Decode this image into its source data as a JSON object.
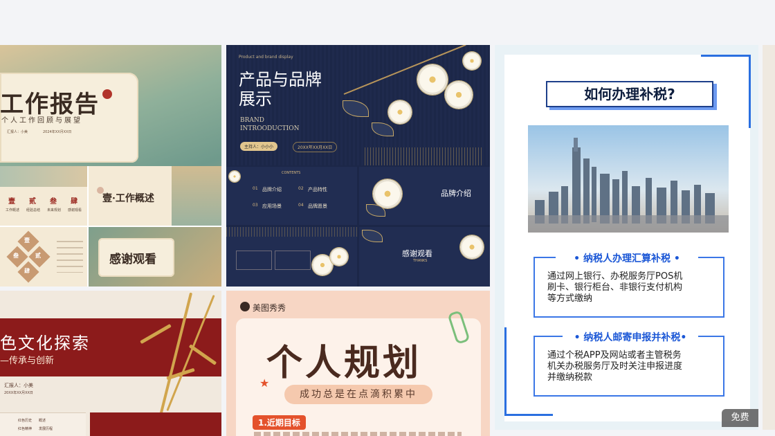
{
  "card1": {
    "title": "工作报告",
    "subtitle": "个人工作回顾与展望",
    "reporter": "汇报人：小美",
    "date": "2024年XX月XX日",
    "slide_title": "壹·工作概述",
    "slide_items": [
      "壹",
      "贰",
      "叁",
      "肆"
    ],
    "slide_item_labels": [
      "工作概述",
      "经验总结",
      "未来规划",
      "感谢观看"
    ],
    "thanks": "感谢观看",
    "diamond_labels": [
      "壹",
      "叁",
      "贰",
      "肆"
    ],
    "colors": {
      "landscape": "#6f9a8c",
      "paper": "#f4ead6",
      "accent": "#9b2a22"
    }
  },
  "card2": {
    "tag": "Product and brand display",
    "title_line1": "产品与品牌",
    "title_line2": "展示",
    "brand": "BRAND",
    "intro": "INTROODUCTION",
    "presenter": "主持人：小小小",
    "date": "20XX年XX月XX日",
    "contents_label": "CONTENTS",
    "contents": [
      {
        "num": "01",
        "label": "品牌介绍"
      },
      {
        "num": "02",
        "label": "产品特性"
      },
      {
        "num": "03",
        "label": "应用场景"
      },
      {
        "num": "04",
        "label": "品牌愿景"
      }
    ],
    "slide_title": "品牌介绍",
    "thanks": "感谢观看",
    "thanks_en": "THANKS",
    "colors": {
      "navy": "#1c2748",
      "gold": "#d8b980"
    }
  },
  "card3": {
    "title": "如何办理补税?",
    "section1": {
      "heading": "• 纳税人办理汇算补税 •",
      "lines": [
        "通过网上银行、办税服务厅POS机",
        "刷卡、银行柜台、非银行支付机构",
        "等方式缴纳"
      ]
    },
    "section2": {
      "heading": "• 纳税人邮寄申报并补税•",
      "lines": [
        "通过个税APP及网站或者主管税务",
        "机关办税服务厅及时关注申报进度",
        "并缴纳税款"
      ]
    },
    "badge": "免费",
    "colors": {
      "accent": "#1b57d6",
      "frame": "#2a6fe0"
    }
  },
  "card4": {
    "title": "色文化探索",
    "subtitle": "—传承与创新",
    "author": "汇报人：小美",
    "date": "20XX年XX月XX日",
    "list_items": [
      "红色历史",
      "红色精神"
    ],
    "list_items_right": [
      "概述",
      "发展历程"
    ],
    "colors": {
      "red": "#8c1b1b",
      "bamboo": "#d1a54d"
    }
  },
  "card5": {
    "brand": "美图秀秀",
    "title": "个人规划",
    "subtitle": "成功总是在点滴积累中",
    "section": "1.近期目标",
    "colors": {
      "bg": "#f7d6c4",
      "accent": "#e4522c"
    }
  }
}
